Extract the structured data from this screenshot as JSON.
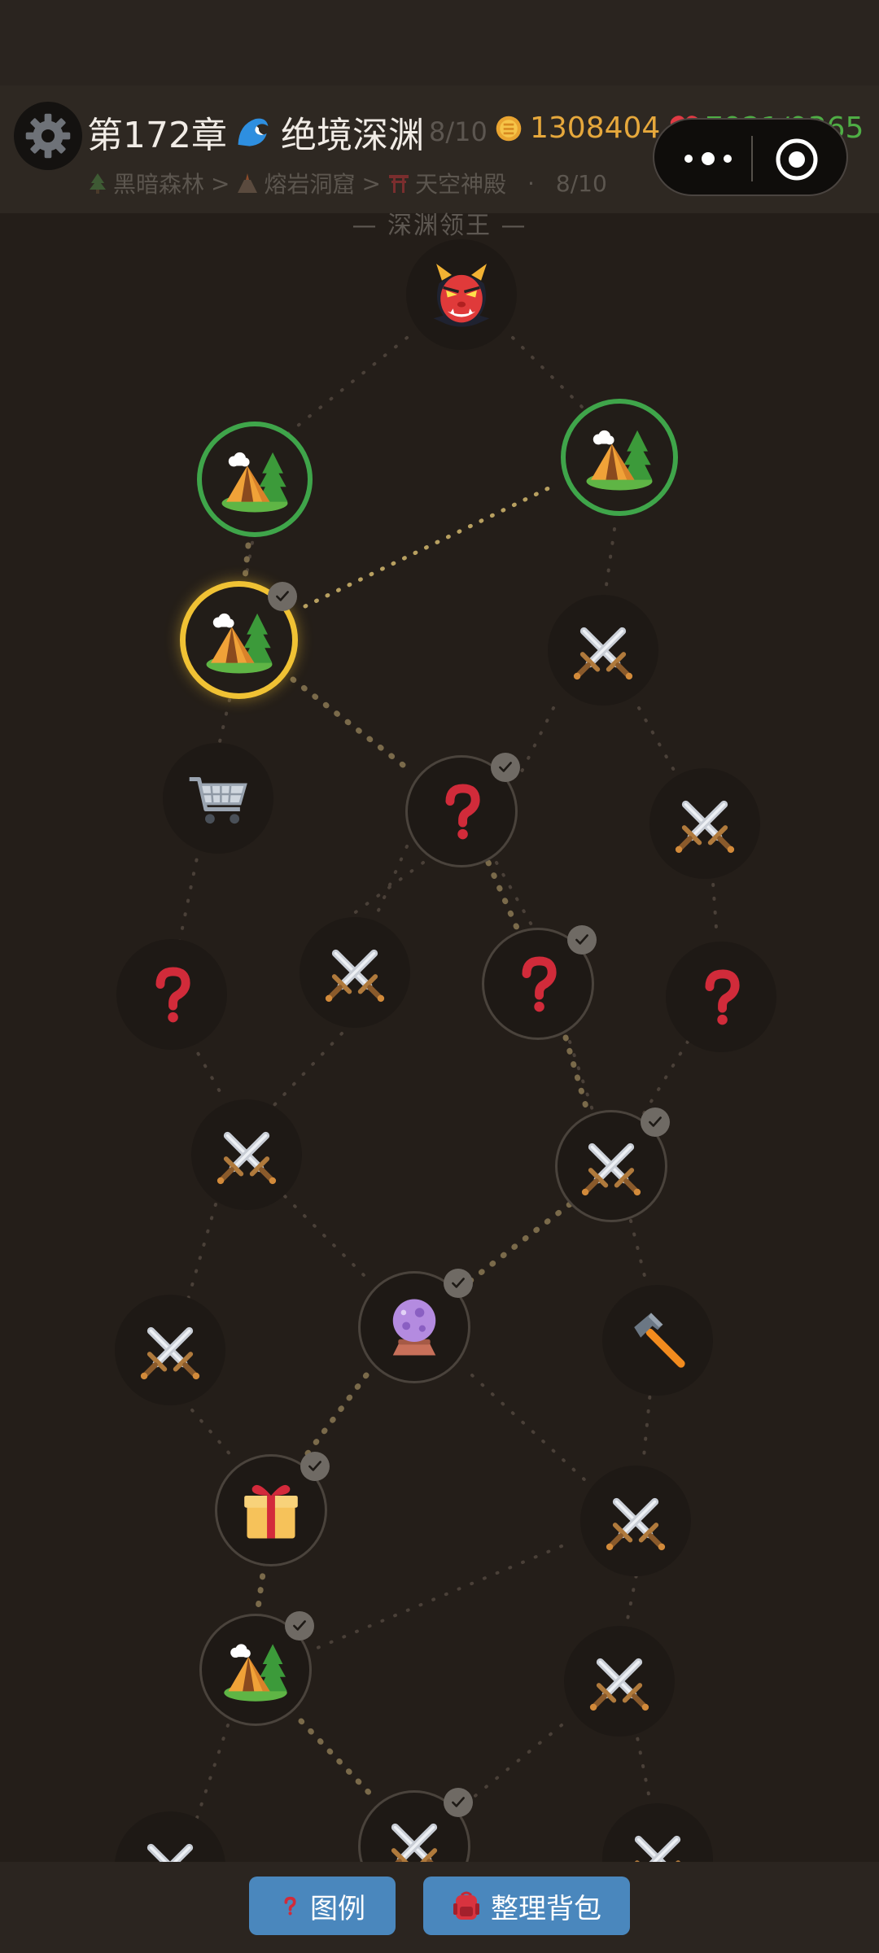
{
  "header": {
    "chapter": "第172章",
    "chapter_name": "绝境深渊",
    "progress": "8/10",
    "gold": "1308404",
    "hp": "7921/9365",
    "breadcrumbs": [
      "黑暗森林",
      "熔岩洞窟",
      "天空神殿"
    ],
    "crumb_sep": ">",
    "crumb_dot": "·",
    "floor_progress": "8/10"
  },
  "map": {
    "boss_label": "— 深渊领王 —",
    "node_types": [
      "boss",
      "camp",
      "battle",
      "shop",
      "event",
      "crystal-ball",
      "forge",
      "gift"
    ]
  },
  "bottom": {
    "legend_label": "图例",
    "bag_label": "整理背包"
  },
  "colors": {
    "background": "#241e19",
    "gold": "#e6a83c",
    "hp": "#4fae45",
    "available_ring": "#3fa54a",
    "current_ring": "#f0c234",
    "button": "#4a87bd"
  }
}
